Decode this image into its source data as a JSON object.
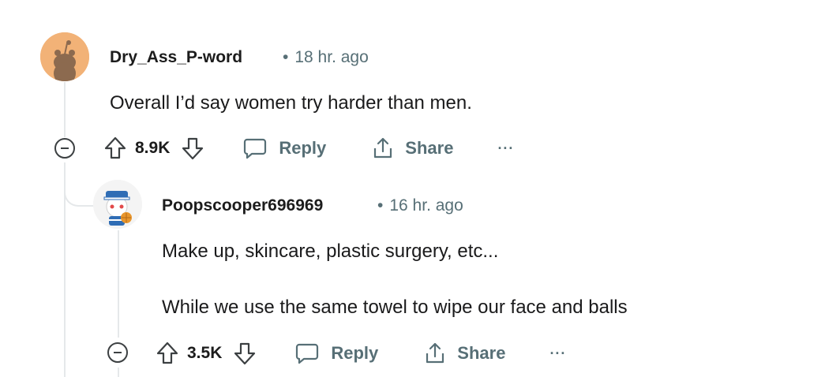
{
  "comments": [
    {
      "username": "Dry_Ass_P-word",
      "separator": "•",
      "time": "18 hr. ago",
      "body": [
        "Overall I’d say women try harder than men."
      ],
      "score": "8.9K",
      "reply_label": "Reply",
      "share_label": "Share",
      "more_label": "···",
      "avatar_colors": {
        "bg": "#f2b277",
        "fg": "#8c6a4f"
      }
    },
    {
      "username": "Poopscooper696969",
      "separator": "•",
      "time": "16 hr. ago",
      "body": [
        "Make up, skincare, plastic surgery, etc...",
        "While we use the same towel to wipe our face and balls"
      ],
      "score": "3.5K",
      "reply_label": "Reply",
      "share_label": "Share",
      "more_label": "···",
      "avatar_colors": {
        "bg": "#f4f4f4",
        "cap": "#2f6db5",
        "ball": "#e8962d"
      }
    }
  ]
}
